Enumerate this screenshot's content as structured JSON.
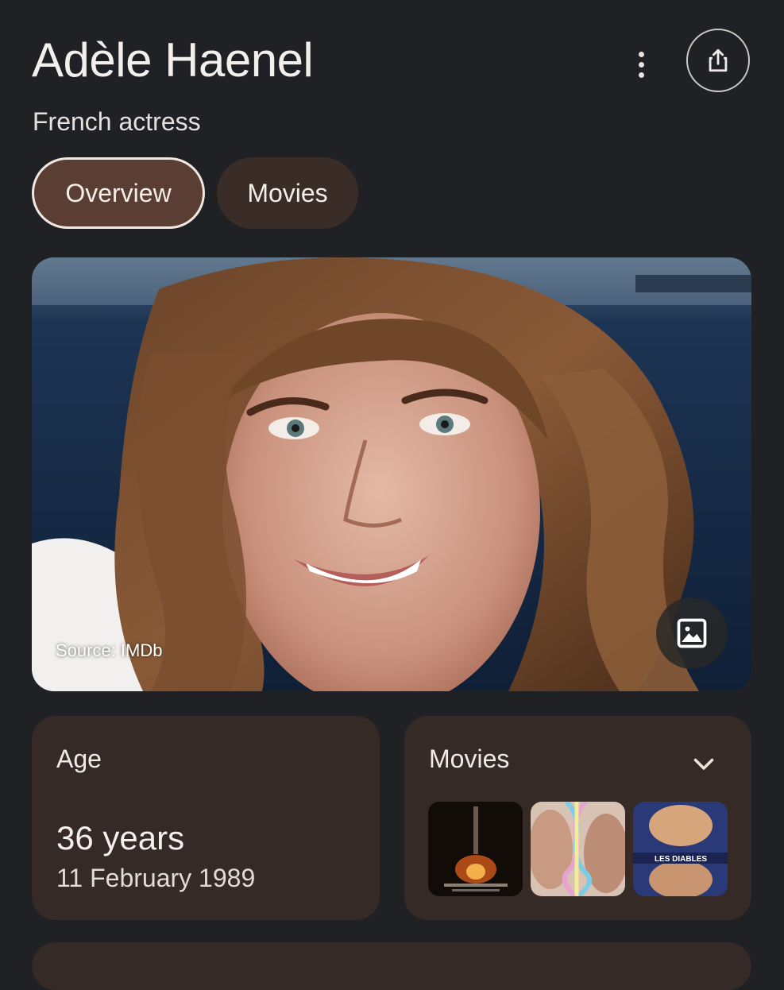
{
  "header": {
    "title": "Adèle Haenel",
    "subtitle": "French actress"
  },
  "actions": {
    "more_icon": "more-vert-icon",
    "share_icon": "share-icon"
  },
  "tabs": [
    {
      "label": "Overview",
      "active": true
    },
    {
      "label": "Movies",
      "active": false
    }
  ],
  "hero": {
    "source": "Source: IMDb",
    "gallery_icon": "image-icon"
  },
  "age_card": {
    "label": "Age",
    "value": "36 years",
    "birth_date": "11 February 1989"
  },
  "movies_card": {
    "label": "Movies",
    "expand_icon": "chevron-down-icon",
    "poster_count": 3,
    "poster_3_text": "LES DIABLES"
  },
  "colors": {
    "background": "#202124",
    "active_tab": "#5a3e33",
    "inactive_tab": "#3a2c26",
    "card": "#352a25"
  }
}
